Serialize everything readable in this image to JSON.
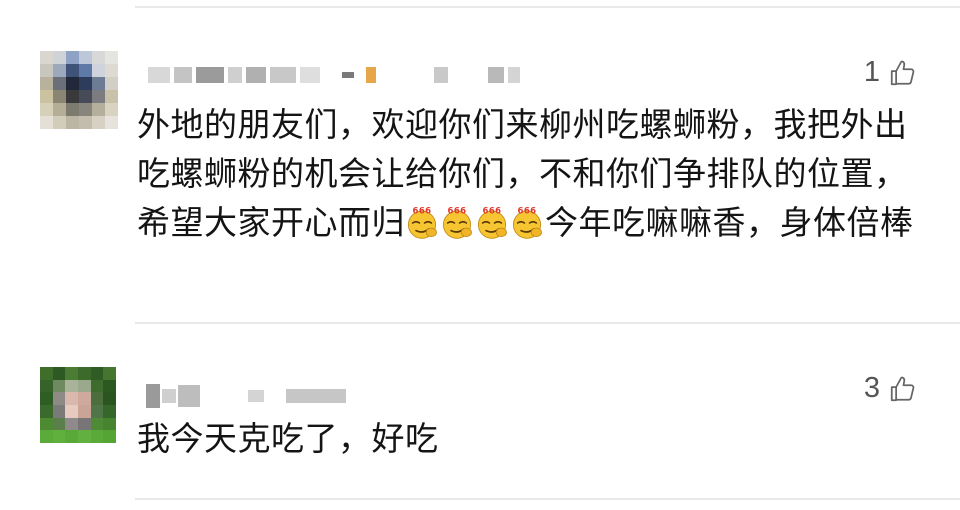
{
  "comments": [
    {
      "likes": "1",
      "text_before": "外地的朋友们，欢迎你们来柳州吃螺蛳粉，我把外出吃螺蛳粉的机会让给你们，不和你们争排队的位置，希望大家开心而归",
      "emoji": {
        "icon": "smirk-666-emoji",
        "label": "666",
        "count": 4
      },
      "text_after": "今年吃嘛嘛香，身体倍棒"
    },
    {
      "likes": "3",
      "text": "我今天克吃了，好吃"
    }
  ],
  "colors": {
    "like_icon": "#666666",
    "divider": "#e9e9e9",
    "emoji_face": "#f7c531",
    "emoji_text": "#e03a2c"
  },
  "icons": {
    "like": "thumbs-up-icon"
  }
}
